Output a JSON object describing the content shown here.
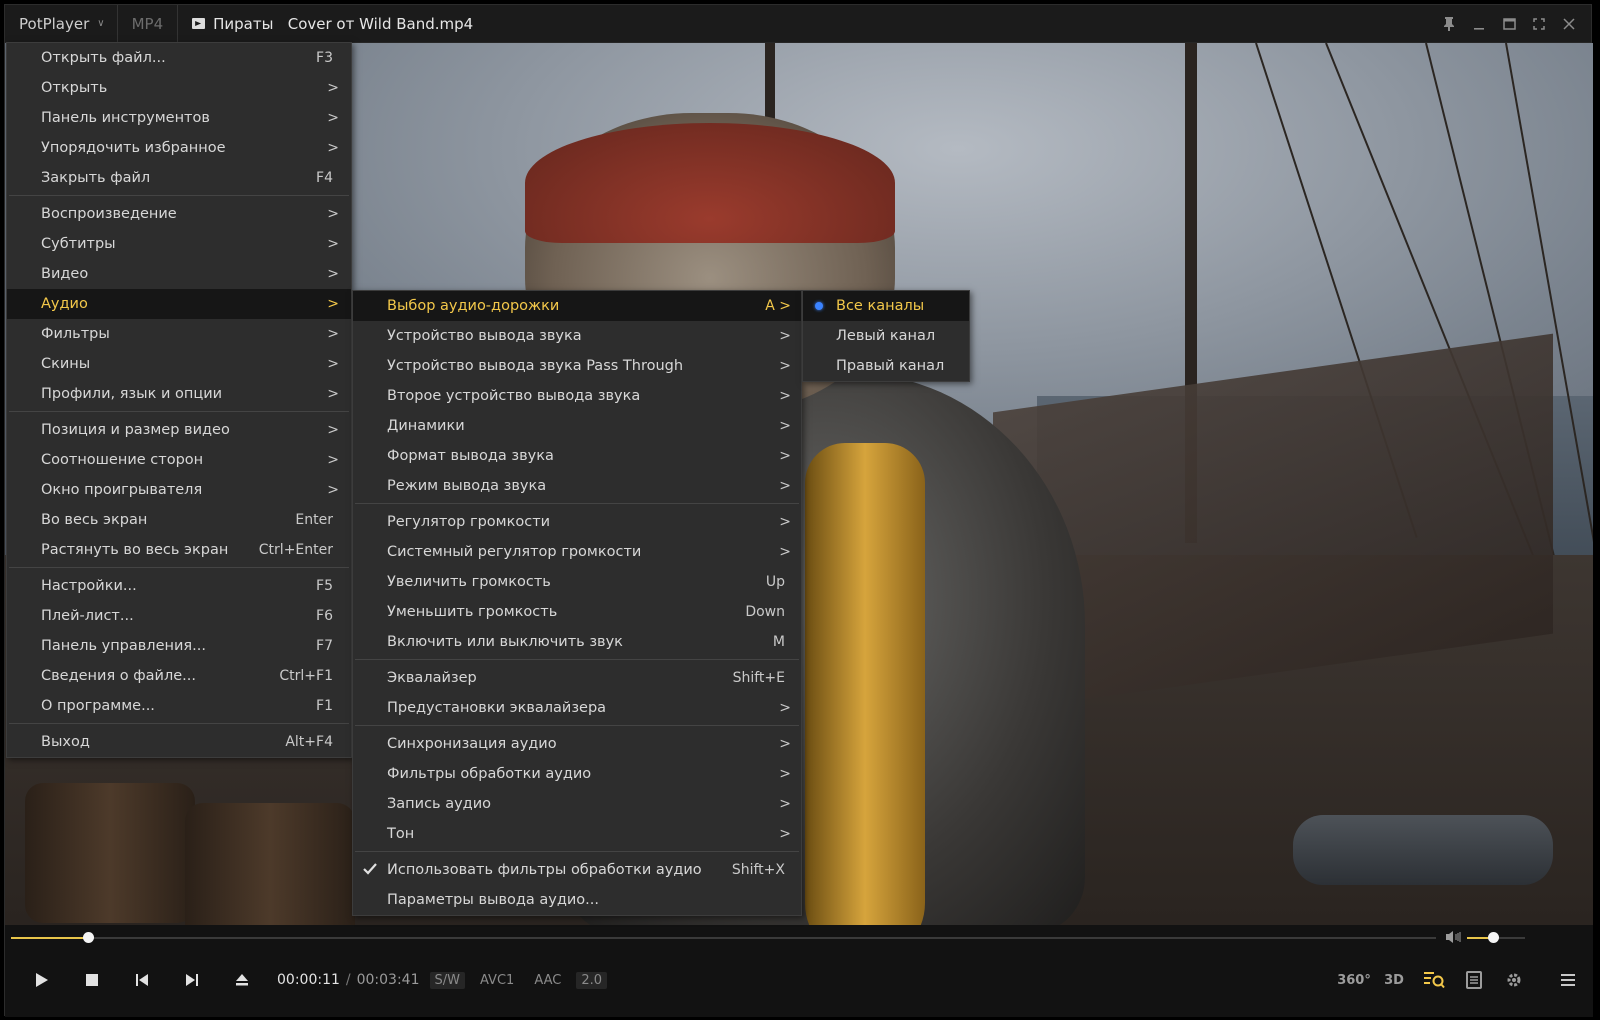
{
  "titlebar": {
    "app_name": "PotPlayer",
    "format": "MP4",
    "file_title": "Пираты   Cover от Wild Band.mp4"
  },
  "main_menu": [
    {
      "label": "Открыть файл...",
      "shortcut": "F3"
    },
    {
      "label": "Открыть",
      "arrow": ">"
    },
    {
      "label": "Панель инструментов",
      "arrow": ">"
    },
    {
      "label": "Упорядочить избранное",
      "arrow": ">"
    },
    {
      "label": "Закрыть файл",
      "shortcut": "F4"
    },
    {
      "label": "Воспроизведение",
      "arrow": ">"
    },
    {
      "label": "Субтитры",
      "arrow": ">"
    },
    {
      "label": "Видео",
      "arrow": ">"
    },
    {
      "label": "Аудио",
      "arrow": ">",
      "active": true
    },
    {
      "label": "Фильтры",
      "arrow": ">"
    },
    {
      "label": "Скины",
      "arrow": ">"
    },
    {
      "label": "Профили, язык и опции",
      "arrow": ">"
    },
    {
      "label": "Позиция и размер видео",
      "arrow": ">"
    },
    {
      "label": "Соотношение сторон",
      "arrow": ">"
    },
    {
      "label": "Окно проигрывателя",
      "arrow": ">"
    },
    {
      "label": "Во весь экран",
      "shortcut": "Enter"
    },
    {
      "label": "Растянуть во весь экран",
      "shortcut": "Ctrl+Enter"
    },
    {
      "label": "Настройки...",
      "shortcut": "F5"
    },
    {
      "label": "Плей-лист...",
      "shortcut": "F6"
    },
    {
      "label": "Панель управления...",
      "shortcut": "F7"
    },
    {
      "label": "Сведения о файле...",
      "shortcut": "Ctrl+F1"
    },
    {
      "label": "О программе...",
      "shortcut": "F1"
    },
    {
      "label": "Выход",
      "shortcut": "Alt+F4"
    }
  ],
  "audio_menu": [
    {
      "label": "Выбор аудио-дорожки",
      "arrow": "A >",
      "active": true
    },
    {
      "label": "Устройство вывода звука",
      "arrow": ">"
    },
    {
      "label": "Устройство вывода звука Pass Through",
      "arrow": ">"
    },
    {
      "label": "Второе устройство вывода звука",
      "arrow": ">"
    },
    {
      "label": "Динамики",
      "arrow": ">"
    },
    {
      "label": "Формат вывода звука",
      "arrow": ">"
    },
    {
      "label": "Режим вывода звука",
      "arrow": ">"
    },
    {
      "label": "Регулятор громкости",
      "arrow": ">"
    },
    {
      "label": "Системный регулятор громкости",
      "arrow": ">"
    },
    {
      "label": "Увеличить громкость",
      "shortcut": "Up"
    },
    {
      "label": "Уменьшить громкость",
      "shortcut": "Down"
    },
    {
      "label": "Включить или выключить звук",
      "shortcut": "M"
    },
    {
      "label": "Эквалайзер",
      "shortcut": "Shift+E"
    },
    {
      "label": "Предустановки эквалайзера",
      "arrow": ">"
    },
    {
      "label": "Синхронизация аудио",
      "arrow": ">"
    },
    {
      "label": "Фильтры обработки аудио",
      "arrow": ">"
    },
    {
      "label": "Запись аудио",
      "arrow": ">"
    },
    {
      "label": "Тон",
      "arrow": ">"
    },
    {
      "label": "Использовать фильтры обработки аудио",
      "shortcut": "Shift+X",
      "checked": true
    },
    {
      "label": "Параметры вывода аудио..."
    }
  ],
  "track_menu": [
    {
      "label": "Все каналы",
      "selected": true
    },
    {
      "label": "Левый канал"
    },
    {
      "label": "Правый канал"
    }
  ],
  "player": {
    "time_current": "00:00:11",
    "time_separator": "/",
    "time_total": "00:03:41",
    "tags": [
      "S/W",
      "AVC1",
      "AAC",
      "2.0"
    ],
    "progress_fraction": 0.054,
    "volume_fraction": 0.45,
    "right_icons": [
      "360°",
      "3D"
    ],
    "accent_color": "#f3c84a"
  }
}
